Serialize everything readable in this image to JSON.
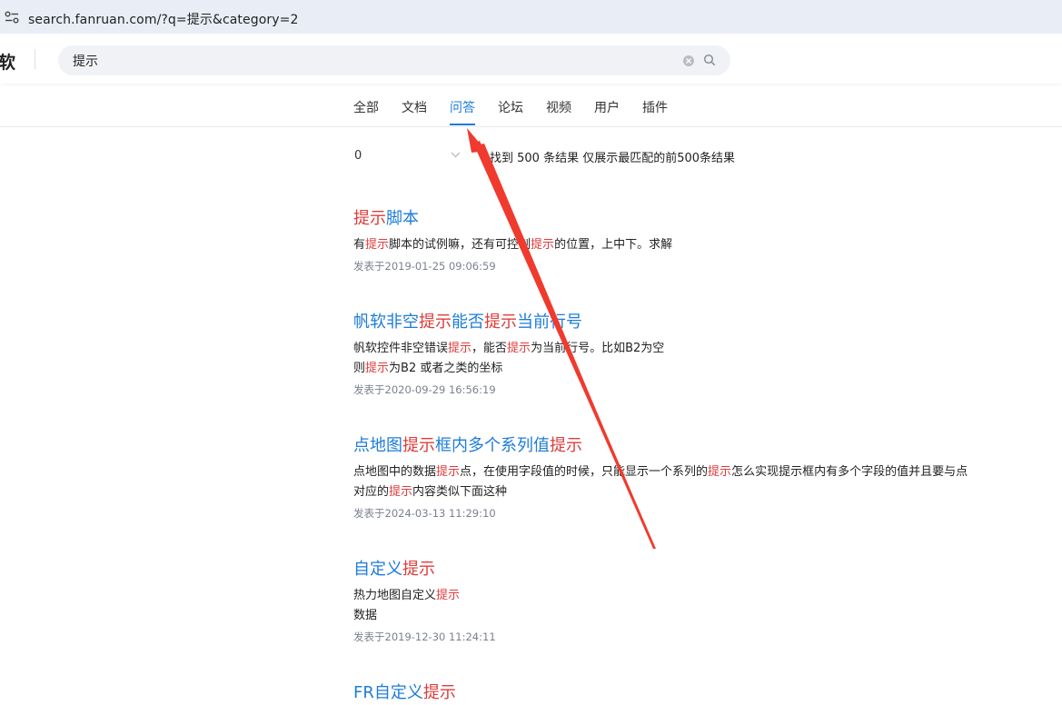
{
  "browser": {
    "url": "search.fanruan.com/?q=提示&category=2"
  },
  "header": {
    "logo": "软",
    "search": {
      "value": "提示"
    }
  },
  "tabs": [
    {
      "label": "全部",
      "active": false
    },
    {
      "label": "文档",
      "active": false
    },
    {
      "label": "问答",
      "active": true
    },
    {
      "label": "论坛",
      "active": false
    },
    {
      "label": "视频",
      "active": false
    },
    {
      "label": "用户",
      "active": false
    },
    {
      "label": "插件",
      "active": false
    }
  ],
  "filter": {
    "selected": "0",
    "result_count": "找到 500 条结果  仅展示最匹配的前500条结果"
  },
  "results": [
    {
      "title": [
        {
          "t": "提示",
          "hl": true
        },
        {
          "t": "脚本",
          "hl": false
        }
      ],
      "snippet": [
        [
          {
            "t": "有",
            "hl": false
          },
          {
            "t": "提示",
            "hl": true
          },
          {
            "t": "脚本的试例嘛，还有可控制",
            "hl": false
          },
          {
            "t": "提示",
            "hl": true
          },
          {
            "t": "的位置，上中下。求解",
            "hl": false
          }
        ]
      ],
      "date": "发表于2019-01-25 09:06:59"
    },
    {
      "title": [
        {
          "t": "帆软非空",
          "hl": false
        },
        {
          "t": "提示",
          "hl": true
        },
        {
          "t": "能否",
          "hl": false
        },
        {
          "t": "提示",
          "hl": true
        },
        {
          "t": "当前行号",
          "hl": false
        }
      ],
      "snippet": [
        [
          {
            "t": "帆软控件非空错误",
            "hl": false
          },
          {
            "t": "提示",
            "hl": true
          },
          {
            "t": "，能否",
            "hl": false
          },
          {
            "t": "提示",
            "hl": true
          },
          {
            "t": "为当前行号。比如B2为空",
            "hl": false
          }
        ],
        [
          {
            "t": "则",
            "hl": false
          },
          {
            "t": "提示",
            "hl": true
          },
          {
            "t": "为B2 或者之类的坐标",
            "hl": false
          }
        ]
      ],
      "date": "发表于2020-09-29 16:56:19"
    },
    {
      "title": [
        {
          "t": "点地图",
          "hl": false
        },
        {
          "t": "提示",
          "hl": true
        },
        {
          "t": "框内多个系列值",
          "hl": false
        },
        {
          "t": "提示",
          "hl": true
        }
      ],
      "snippet": [
        [
          {
            "t": "点地图中的数据",
            "hl": false
          },
          {
            "t": "提示",
            "hl": true
          },
          {
            "t": "点，在使用字段值的时候，只能显示一个系列的",
            "hl": false
          },
          {
            "t": "提示",
            "hl": true
          },
          {
            "t": "怎么实现提示框内有多个字段的值并且要与点",
            "hl": false
          }
        ],
        [
          {
            "t": "对应的",
            "hl": false
          },
          {
            "t": "提示",
            "hl": true
          },
          {
            "t": "内容类似下面这种",
            "hl": false
          }
        ]
      ],
      "date": "发表于2024-03-13 11:29:10"
    },
    {
      "title": [
        {
          "t": "自定义",
          "hl": false
        },
        {
          "t": "提示",
          "hl": true
        }
      ],
      "snippet": [
        [
          {
            "t": "热力地图自定义",
            "hl": false
          },
          {
            "t": "提示",
            "hl": true
          }
        ],
        [
          {
            "t": "数据",
            "hl": false
          }
        ]
      ],
      "date": "发表于2019-12-30 11:24:11"
    },
    {
      "title": [
        {
          "t": "FR自定义",
          "hl": false
        },
        {
          "t": "提示",
          "hl": true
        }
      ],
      "snippet": [],
      "date": ""
    }
  ],
  "colors": {
    "accent": "#1d7cd8",
    "highlight": "#e03b3b",
    "annotation": "#f03a2e"
  },
  "icons": [
    "site-info-icon",
    "clear-icon",
    "search-icon",
    "chevron-down-icon"
  ]
}
